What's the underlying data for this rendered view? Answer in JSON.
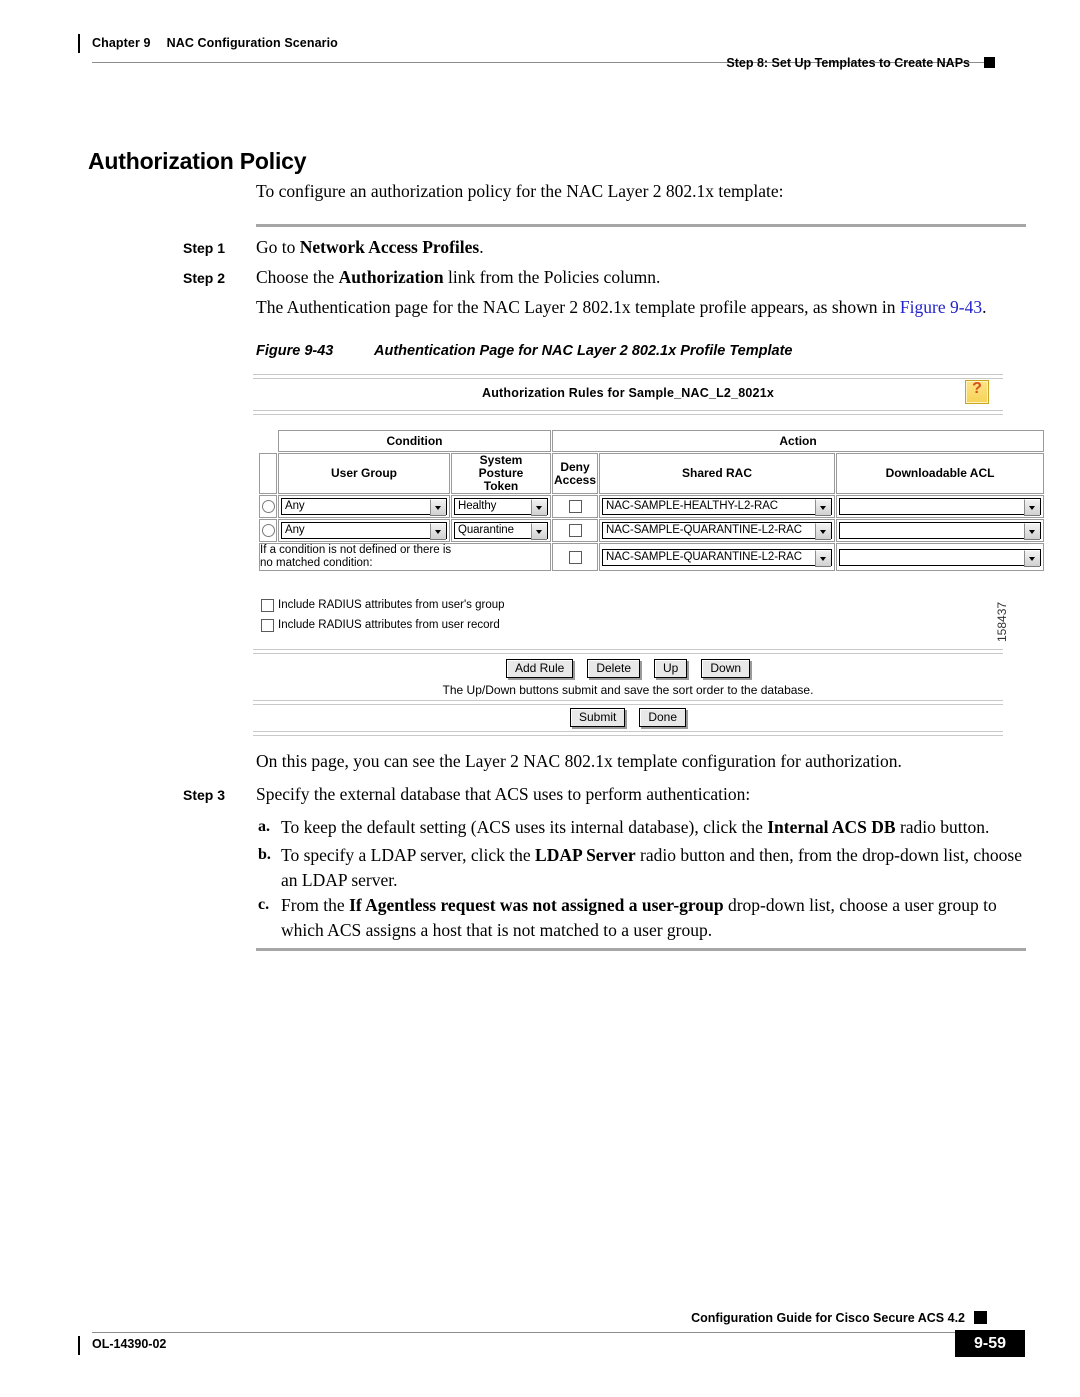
{
  "header": {
    "chapter": "Chapter 9",
    "chapter_title": "NAC Configuration Scenario",
    "running_head": "Step 8: Set Up Templates to Create NAPs"
  },
  "page_title": "Authorization Policy",
  "intro": "To configure an authorization policy for the NAC Layer 2 802.1x template:",
  "steps": [
    {
      "label": "Step 1",
      "text_before": "Go to ",
      "bold": "Network Access Profiles",
      "text_after": "."
    },
    {
      "label": "Step 2",
      "text_before": "Choose the ",
      "bold": "Authorization",
      "text_after": " link from the Policies column."
    }
  ],
  "after_step2": {
    "text_before": "The Authentication page for the NAC Layer 2 802.1x template profile appears, as shown in ",
    "link": "Figure 9-43",
    "text_after": "."
  },
  "figure": {
    "caption_number": "Figure 9-43",
    "caption_title": "Authentication Page for NAC Layer 2 802.1x Profile Template",
    "figure_id": "158437",
    "panel_title": "Authorization Rules for Sample_NAC_L2_8021x",
    "help_icon_glyph": "?",
    "group_headers": [
      "Condition",
      "Action"
    ],
    "column_headers": [
      "User Group",
      "System Posture Token",
      "Deny Access",
      "Shared RAC",
      "Downloadable ACL"
    ],
    "column_header_lines": {
      "user_group": [
        "User Group"
      ],
      "system_posture_token": [
        "System",
        "Posture",
        "Token"
      ],
      "deny_access": [
        "Deny",
        "Access"
      ],
      "shared_rac": [
        "Shared RAC"
      ],
      "downloadable_acl": [
        "Downloadable ACL"
      ]
    },
    "rows": [
      {
        "selected": false,
        "user_group": "Any",
        "system_posture_token": "Healthy",
        "deny_access": false,
        "shared_rac": "NAC-SAMPLE-HEALTHY-L2-RAC",
        "downloadable_acl": ""
      },
      {
        "selected": false,
        "user_group": "Any",
        "system_posture_token": "Quarantine",
        "deny_access": false,
        "shared_rac": "NAC-SAMPLE-QUARANTINE-L2-RAC",
        "downloadable_acl": ""
      }
    ],
    "default_row": {
      "label_line1": "If a condition is not defined or there is",
      "label_line2": "no matched condition:",
      "deny_access": false,
      "shared_rac": "NAC-SAMPLE-QUARANTINE-L2-RAC",
      "downloadable_acl": ""
    },
    "checkboxes": [
      {
        "label": "Include RADIUS attributes from user's group",
        "checked": false
      },
      {
        "label": "Include RADIUS attributes from user record",
        "checked": false
      }
    ],
    "buttons_row1": [
      "Add Rule",
      "Delete",
      "Up",
      "Down"
    ],
    "hint": "The Up/Down buttons submit and save the sort order to the database.",
    "buttons_row2": [
      "Submit",
      "Done"
    ]
  },
  "after_figure": "On this page, you can see the Layer 2 NAC 802.1x template configuration for authorization.",
  "step3": {
    "label": "Step 3",
    "text": "Specify the external database that ACS uses to perform authentication:"
  },
  "substeps": [
    {
      "label": "a.",
      "text_before": "To keep the default setting (ACS uses its internal database), click the ",
      "bold": "Internal ACS DB",
      "text_after": " radio button."
    },
    {
      "label": "b.",
      "text_before": "To specify a LDAP server, click the ",
      "bold": "LDAP Server",
      "text_after": " radio button and then, from the drop-down list, choose an LDAP server."
    },
    {
      "label": "c.",
      "text_before": "From the ",
      "bold": "If Agentless request was not assigned a user-group",
      "text_after": " drop-down list, choose a user group to which ACS assigns a host that is not matched to a user group."
    }
  ],
  "footer": {
    "doc_id": "OL-14390-02",
    "guide_title": "Configuration Guide for Cisco Secure ACS 4.2",
    "page_number": "9-59"
  },
  "colors": {
    "link": "#2222cc",
    "rule_gray": "#a6a6a6",
    "help_icon_bg": "#f6d255",
    "help_icon_fg": "#d94f18"
  }
}
